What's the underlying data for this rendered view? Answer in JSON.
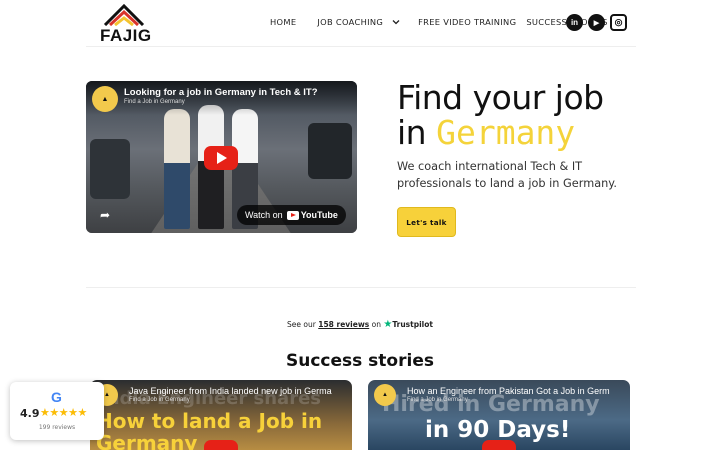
{
  "header": {
    "logo_text": "FAJIG",
    "nav": [
      {
        "label": "HOME"
      },
      {
        "label": "JOB COACHING",
        "has_dropdown": true
      },
      {
        "label": "FREE VIDEO TRAINING"
      },
      {
        "label": "SUCCESS STORIES"
      }
    ],
    "socials": [
      {
        "icon": "linkedin-icon",
        "glyph": "in"
      },
      {
        "icon": "youtube-icon",
        "glyph": "▶"
      },
      {
        "icon": "instagram-icon",
        "glyph": "◎"
      }
    ]
  },
  "hero": {
    "video": {
      "title": "Looking for a job in Germany in Tech & IT?",
      "channel": "Find a Job in Germany",
      "watch_label": "Watch on",
      "youtube_label": "YouTube"
    },
    "title_line1": "Find your job",
    "title_line2_prefix": "in",
    "title_accent": "Germany",
    "description": "We coach international Tech & IT professionals to land a job in Germany.",
    "cta_label": "Let's talk"
  },
  "trustpilot": {
    "prefix": "See our",
    "count": "158 reviews",
    "middle": "on",
    "brand": "Trustpilot"
  },
  "success": {
    "title": "Success stories",
    "videos": [
      {
        "title": "Java Engineer from India landed new job in Germa",
        "channel": "Find a Job in Germany",
        "ghost": "India Engineer shares",
        "big1": "How to land a Job in",
        "big2": "Germany"
      },
      {
        "title": "How an Engineer from Pakistan Got a Job in Germ",
        "channel": "Find a Job in Germany",
        "ghost": "Hired in Germany",
        "big1": "in 90 Days!"
      }
    ]
  },
  "google_widget": {
    "logo": "G",
    "rating": "4.9",
    "stars": "★★★★★",
    "reviews": "199 reviews"
  },
  "colors": {
    "accent": "#f7d13a",
    "youtube_red": "#e62117",
    "trustpilot_green": "#00b67a"
  }
}
